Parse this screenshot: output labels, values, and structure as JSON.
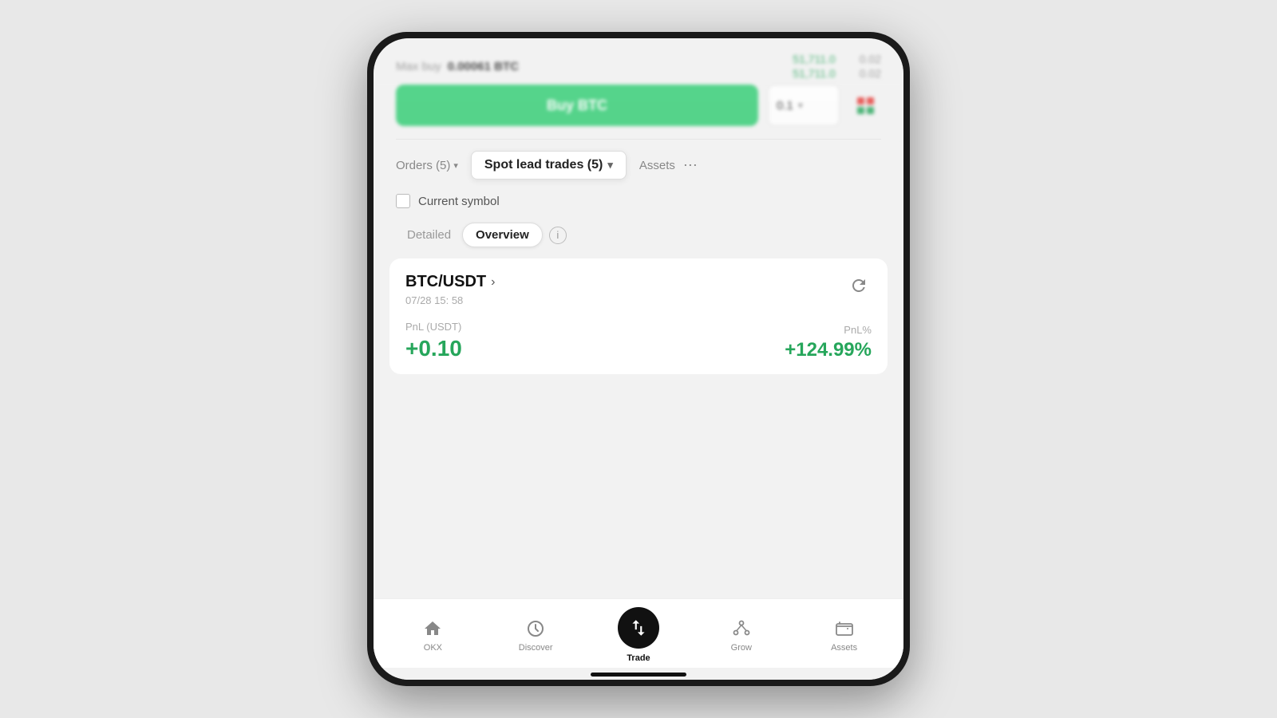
{
  "phone": {
    "top_blur": {
      "max_buy_label": "Max buy",
      "max_buy_value": "0.00061 BTC",
      "price_row1_price": "51,711.0",
      "price_row1_qty": "0.02",
      "price_row2_price": "51,711.0",
      "price_row2_qty": "0.02",
      "buy_btn_label": "Buy BTC",
      "qty_value": "0.1"
    },
    "tabs": {
      "orders_label": "Orders (5)",
      "spot_lead_label": "Spot lead trades (5)",
      "assets_label": "Assets",
      "more": "⋯"
    },
    "filter": {
      "current_symbol_label": "Current symbol"
    },
    "view_toggle": {
      "detailed_label": "Detailed",
      "overview_label": "Overview"
    },
    "trade_card": {
      "pair": "BTC/USDT",
      "date": "07/28 15: 58",
      "pnl_usdt_label": "PnL (USDT)",
      "pnl_usdt_value": "+0.10",
      "pnl_pct_label": "PnL%",
      "pnl_pct_value": "+124.99%"
    },
    "bottom_nav": {
      "okx_label": "OKX",
      "discover_label": "Discover",
      "trade_label": "Trade",
      "grow_label": "Grow",
      "assets_label": "Assets"
    }
  }
}
